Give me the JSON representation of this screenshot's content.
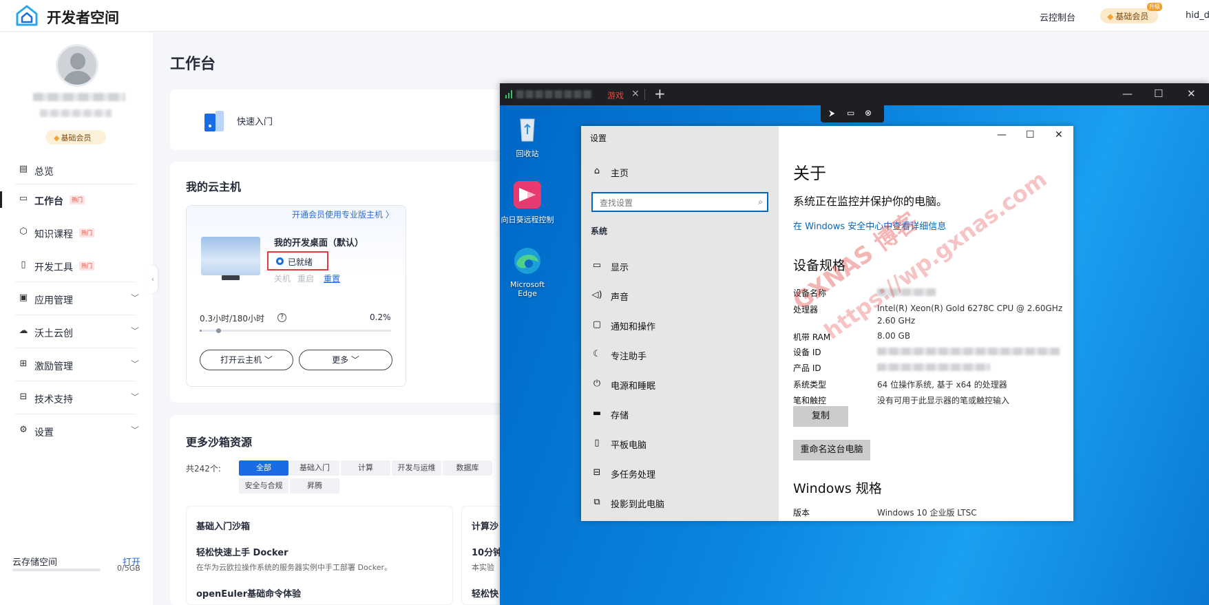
{
  "topbar": {
    "brand": "开发者空间",
    "console_link": "云控制台",
    "member_label": "基础会员",
    "upgrade_tag": "升级",
    "user": "hid_d"
  },
  "sidebar": {
    "member_badge": "基础会员",
    "items": [
      {
        "label": "总览",
        "icon": "overview-icon",
        "hot": ""
      },
      {
        "label": "工作台",
        "icon": "workbench-icon",
        "hot": "热门"
      },
      {
        "label": "知识课程",
        "icon": "cube-icon",
        "hot": "热门"
      },
      {
        "label": "开发工具",
        "icon": "tools-icon",
        "hot": "热门"
      },
      {
        "label": "应用管理",
        "icon": "app-icon",
        "hot": ""
      },
      {
        "label": "沃土云创",
        "icon": "cloud-icon",
        "hot": ""
      },
      {
        "label": "激励管理",
        "icon": "gift-icon",
        "hot": ""
      },
      {
        "label": "技术支持",
        "icon": "support-icon",
        "hot": ""
      },
      {
        "label": "设置",
        "icon": "gear-icon",
        "hot": ""
      }
    ],
    "storage": {
      "label": "云存储空间",
      "open": "打开",
      "value": "0/5GB",
      "used_fraction": 0
    }
  },
  "main": {
    "title": "工作台",
    "quick_start": "快速入门",
    "my_vm": {
      "section_title": "我的云主机",
      "promo": "开通会员使用专业版主机 〉",
      "name": "我的开发桌面（默认）",
      "status": "已就绪",
      "actions": [
        "关机",
        "重启",
        "重置"
      ],
      "hours": "0.3小时/180小时",
      "percent": "0.2%",
      "usage_fraction": 0.002,
      "open_button": "打开云主机 ﹀",
      "more_button": "更多 ﹀"
    },
    "sandbox": {
      "title": "更多沙箱资源",
      "count": "共242个:",
      "chips": [
        "全部",
        "基础入门",
        "计算",
        "开发与运维",
        "数据库",
        "安全与合规",
        "昇腾"
      ],
      "card1": {
        "head": "基础入门沙箱",
        "item1_title": "轻松快速上手 Docker",
        "item1_desc": "在华为云欧拉操作系统的服务器实例中手工部署 Docker。",
        "item2_title": "openEuler基础命令体验"
      },
      "card2": {
        "head": "计算沙",
        "item1_title": "10分钟",
        "item1_desc": "本实验",
        "item2_title": "轻松快"
      }
    }
  },
  "remote": {
    "tab_label": "游戏",
    "desktop_icons": [
      "回收站",
      "向日葵远程控制",
      "Microsoft Edge"
    ],
    "settings": {
      "window_title": "设置",
      "home": "主页",
      "search_placeholder": "查找设置",
      "system": "系统",
      "nav": [
        {
          "label": "显示",
          "icon": "monitor-icon"
        },
        {
          "label": "声音",
          "icon": "speaker-icon"
        },
        {
          "label": "通知和操作",
          "icon": "notification-icon"
        },
        {
          "label": "专注助手",
          "icon": "moon-icon"
        },
        {
          "label": "电源和睡眠",
          "icon": "power-icon"
        },
        {
          "label": "存储",
          "icon": "storage-icon"
        },
        {
          "label": "平板电脑",
          "icon": "tablet-icon"
        },
        {
          "label": "多任务处理",
          "icon": "multitask-icon"
        },
        {
          "label": "投影到此电脑",
          "icon": "project-icon"
        }
      ],
      "about_title": "关于",
      "protect_text": "系统正在监控并保护你的电脑。",
      "security_link": "在 Windows 安全中心中查看详细信息",
      "device_spec_title": "设备规格",
      "specs": [
        {
          "k": "设备名称",
          "v": ""
        },
        {
          "k": "处理器",
          "v": "Intel(R) Xeon(R) Gold 6278C CPU @ 2.60GHz"
        },
        {
          "k": "",
          "v": "2.60 GHz"
        },
        {
          "k": "机带 RAM",
          "v": "8.00 GB"
        },
        {
          "k": "设备 ID",
          "v": ""
        },
        {
          "k": "产品 ID",
          "v": ""
        },
        {
          "k": "系统类型",
          "v": "64 位操作系统, 基于 x64 的处理器"
        },
        {
          "k": "笔和触控",
          "v": "没有可用于此显示器的笔或触控输入"
        }
      ],
      "copy_button": "复制",
      "rename_button": "重命名这台电脑",
      "windows_spec_title": "Windows 规格",
      "edition_key": "版本",
      "edition_value": "Windows 10 企业版 LTSC"
    }
  },
  "watermark": {
    "line1": "GXNAS 博客",
    "line2": "https://wp.gxnas.com"
  },
  "colors": {
    "accent": "#1a6be6",
    "hot": "#e5483b",
    "member": "#fbe9c9",
    "win_blue": "#0a74d6",
    "highlight_border": "#e23b3b"
  }
}
